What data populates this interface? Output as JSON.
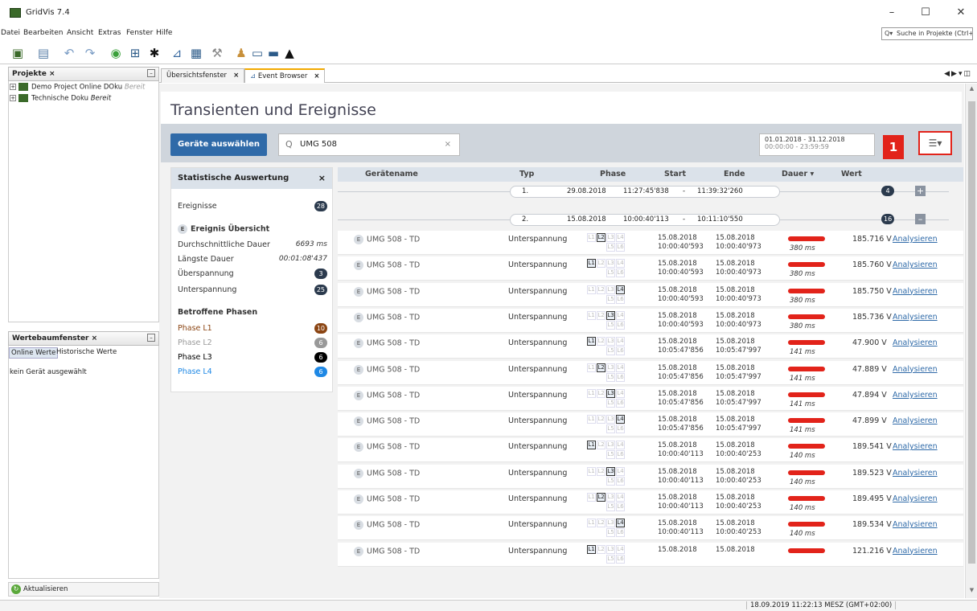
{
  "window": {
    "app_title": "GridVis 7.4",
    "minimize": "–",
    "maximize": "☐",
    "close": "✕"
  },
  "menu": {
    "items": [
      "Datei",
      "Bearbeiten",
      "Ansicht",
      "Extras",
      "Fenster",
      "Hilfe"
    ],
    "search_placeholder": "Suche in Projekte (Ctrl+I)"
  },
  "toolbar": {
    "icons": [
      "open-project-icon",
      "save-icon",
      "undo-icon",
      "refresh-icon",
      "online-icon",
      "import-icon",
      "connect-icon",
      "chart-icon",
      "graph-icon",
      "tools-icon",
      "users-icon",
      "device-icon",
      "report-icon",
      "learn-icon"
    ]
  },
  "projects": {
    "header": "Projekte",
    "items": [
      {
        "name": "Demo Project Online DOku",
        "state": "Bereit"
      },
      {
        "name": "Technische Doku",
        "state": "Bereit"
      }
    ]
  },
  "werte": {
    "header": "Wertebaumfenster",
    "tab_online": "Online Werte",
    "tab_hist": "Historische Werte",
    "empty": "kein Gerät ausgewählt",
    "refresh": "Aktualisieren"
  },
  "tabs": [
    {
      "label": "Übersichtsfenster"
    },
    {
      "label": "Event Browser"
    }
  ],
  "page": {
    "title": "Transienten und Ereignisse",
    "select_devices": "Geräte auswählen",
    "search_value": "UMG 508",
    "date_range": "01.01.2018 - 31.12.2018",
    "time_range": "00:00:00 - 23:59:59",
    "callout": "1"
  },
  "stats": {
    "title": "Statistische Auswertung",
    "events_label": "Ereignisse",
    "events_count": "28",
    "overview_title": "Ereignis Übersicht",
    "avg_label": "Durchschnittliche Dauer",
    "avg_value": "6693 ms",
    "max_label": "Längste Dauer",
    "max_value": "00:01:08'437",
    "over_label": "Überspannung",
    "over_count": "3",
    "under_label": "Unterspannung",
    "under_count": "25",
    "phases_title": "Betroffene Phasen",
    "phases": [
      {
        "label": "Phase L1",
        "count": "10",
        "color": "#8b4513"
      },
      {
        "label": "Phase L2",
        "count": "6",
        "color": "#999999"
      },
      {
        "label": "Phase L3",
        "count": "6",
        "color": "#000000"
      },
      {
        "label": "Phase L4",
        "count": "6",
        "color": "#1e88e5"
      }
    ]
  },
  "columns": {
    "name": "Gerätename",
    "typ": "Typ",
    "phase": "Phase",
    "start": "Start",
    "ende": "Ende",
    "dauer": "Dauer ▾",
    "wert": "Wert"
  },
  "groups": [
    {
      "idx": "1.",
      "date": "29.08.2018",
      "from": "11:27:45'838",
      "sep": "-",
      "to": "11:39:32'260",
      "count": "4",
      "toggle": "+"
    },
    {
      "idx": "2.",
      "date": "15.08.2018",
      "from": "10:00:40'113",
      "sep": "-",
      "to": "10:11:10'550",
      "count": "16",
      "toggle": "–"
    }
  ],
  "event_badge": "E",
  "events": [
    {
      "device": "UMG 508 - TD",
      "typ": "Unterspannung",
      "phase": "L2",
      "start_d": "15.08.2018",
      "start_t": "10:00:40'593",
      "end_d": "15.08.2018",
      "end_t": "10:00:40'973",
      "dur": "380 ms",
      "wert": "185.716 V",
      "action": "Analysieren"
    },
    {
      "device": "UMG 508 - TD",
      "typ": "Unterspannung",
      "phase": "L1",
      "start_d": "15.08.2018",
      "start_t": "10:00:40'593",
      "end_d": "15.08.2018",
      "end_t": "10:00:40'973",
      "dur": "380 ms",
      "wert": "185.760 V",
      "action": "Analysieren"
    },
    {
      "device": "UMG 508 - TD",
      "typ": "Unterspannung",
      "phase": "L4",
      "start_d": "15.08.2018",
      "start_t": "10:00:40'593",
      "end_d": "15.08.2018",
      "end_t": "10:00:40'973",
      "dur": "380 ms",
      "wert": "185.750 V",
      "action": "Analysieren"
    },
    {
      "device": "UMG 508 - TD",
      "typ": "Unterspannung",
      "phase": "L3",
      "start_d": "15.08.2018",
      "start_t": "10:00:40'593",
      "end_d": "15.08.2018",
      "end_t": "10:00:40'973",
      "dur": "380 ms",
      "wert": "185.736 V",
      "action": "Analysieren"
    },
    {
      "device": "UMG 508 - TD",
      "typ": "Unterspannung",
      "phase": "L1",
      "start_d": "15.08.2018",
      "start_t": "10:05:47'856",
      "end_d": "15.08.2018",
      "end_t": "10:05:47'997",
      "dur": "141 ms",
      "wert": "47.900 V",
      "action": "Analysieren"
    },
    {
      "device": "UMG 508 - TD",
      "typ": "Unterspannung",
      "phase": "L2",
      "start_d": "15.08.2018",
      "start_t": "10:05:47'856",
      "end_d": "15.08.2018",
      "end_t": "10:05:47'997",
      "dur": "141 ms",
      "wert": "47.889 V",
      "action": "Analysieren"
    },
    {
      "device": "UMG 508 - TD",
      "typ": "Unterspannung",
      "phase": "L3",
      "start_d": "15.08.2018",
      "start_t": "10:05:47'856",
      "end_d": "15.08.2018",
      "end_t": "10:05:47'997",
      "dur": "141 ms",
      "wert": "47.894 V",
      "action": "Analysieren"
    },
    {
      "device": "UMG 508 - TD",
      "typ": "Unterspannung",
      "phase": "L4",
      "start_d": "15.08.2018",
      "start_t": "10:05:47'856",
      "end_d": "15.08.2018",
      "end_t": "10:05:47'997",
      "dur": "141 ms",
      "wert": "47.899 V",
      "action": "Analysieren"
    },
    {
      "device": "UMG 508 - TD",
      "typ": "Unterspannung",
      "phase": "L1",
      "start_d": "15.08.2018",
      "start_t": "10:00:40'113",
      "end_d": "15.08.2018",
      "end_t": "10:00:40'253",
      "dur": "140 ms",
      "wert": "189.541 V",
      "action": "Analysieren"
    },
    {
      "device": "UMG 508 - TD",
      "typ": "Unterspannung",
      "phase": "L3",
      "start_d": "15.08.2018",
      "start_t": "10:00:40'113",
      "end_d": "15.08.2018",
      "end_t": "10:00:40'253",
      "dur": "140 ms",
      "wert": "189.523 V",
      "action": "Analysieren"
    },
    {
      "device": "UMG 508 - TD",
      "typ": "Unterspannung",
      "phase": "L2",
      "start_d": "15.08.2018",
      "start_t": "10:00:40'113",
      "end_d": "15.08.2018",
      "end_t": "10:00:40'253",
      "dur": "140 ms",
      "wert": "189.495 V",
      "action": "Analysieren"
    },
    {
      "device": "UMG 508 - TD",
      "typ": "Unterspannung",
      "phase": "L4",
      "start_d": "15.08.2018",
      "start_t": "10:00:40'113",
      "end_d": "15.08.2018",
      "end_t": "10:00:40'253",
      "dur": "140 ms",
      "wert": "189.534 V",
      "action": "Analysieren"
    },
    {
      "device": "UMG 508 - TD",
      "typ": "Unterspannung",
      "phase": "L1",
      "start_d": "15.08.2018",
      "start_t": "",
      "end_d": "15.08.2018",
      "end_t": "",
      "dur": "",
      "wert": "121.216 V",
      "action": "Analysieren"
    }
  ],
  "status": {
    "time": "18.09.2019 11:22:13 MESZ (GMT+02:00)"
  }
}
